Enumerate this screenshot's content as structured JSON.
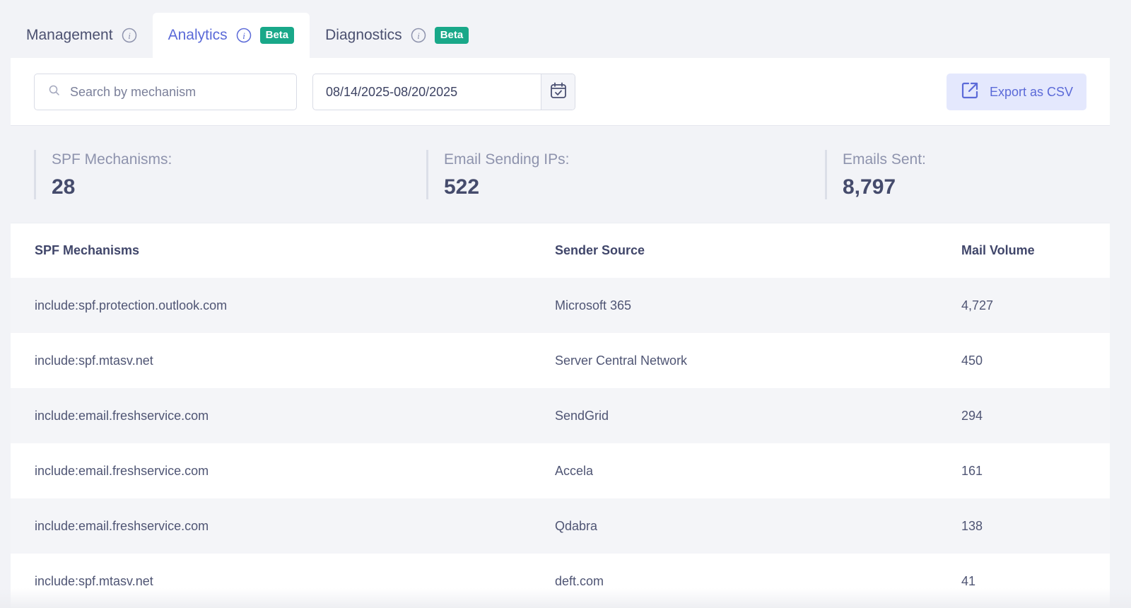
{
  "tabs": [
    {
      "label": "Management",
      "badge": ""
    },
    {
      "label": "Analytics",
      "badge": "Beta"
    },
    {
      "label": "Diagnostics",
      "badge": "Beta"
    }
  ],
  "toolbar": {
    "search_placeholder": "Search by mechanism",
    "date_range": "08/14/2025-08/20/2025",
    "export_label": "Export as CSV"
  },
  "stats": [
    {
      "label": "SPF Mechanisms:",
      "value": "28"
    },
    {
      "label": "Email Sending IPs:",
      "value": "522"
    },
    {
      "label": "Emails Sent:",
      "value": "8,797"
    }
  ],
  "table": {
    "headers": [
      "SPF Mechanisms",
      "Sender Source",
      "Mail Volume"
    ],
    "rows": [
      [
        "include:spf.protection.outlook.com",
        "Microsoft 365",
        "4,727"
      ],
      [
        "include:spf.mtasv.net",
        "Server Central Network",
        "450"
      ],
      [
        "include:email.freshservice.com",
        "SendGrid",
        "294"
      ],
      [
        "include:email.freshservice.com",
        "Accela",
        "161"
      ],
      [
        "include:email.freshservice.com",
        "Qdabra",
        "138"
      ],
      [
        "include:spf.mtasv.net",
        "deft.com",
        "41"
      ]
    ]
  },
  "colors": {
    "accent": "#5b6ad8",
    "badge": "#19a889",
    "export_bg": "#e4e8fd",
    "page_bg": "#f2f3f7"
  }
}
